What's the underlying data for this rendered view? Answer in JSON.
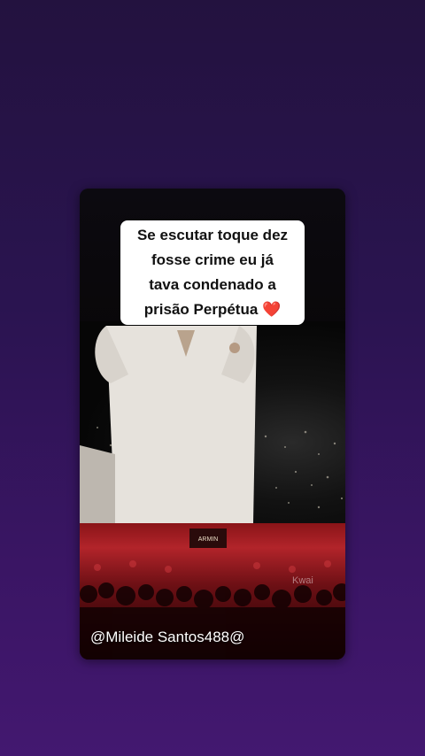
{
  "caption": {
    "line1": "Se escutar toque dez",
    "line2": "fosse crime eu já",
    "line3": "tava condenado a",
    "line4": "prisão Perpétua",
    "emoji": "❤️"
  },
  "watermark": "Kwai",
  "username": "@Mileide Santos488@",
  "colors": {
    "background_top": "#23123f",
    "background_bottom": "#431870",
    "crowd_red": "#b2242a",
    "heart": "#e0161c"
  }
}
